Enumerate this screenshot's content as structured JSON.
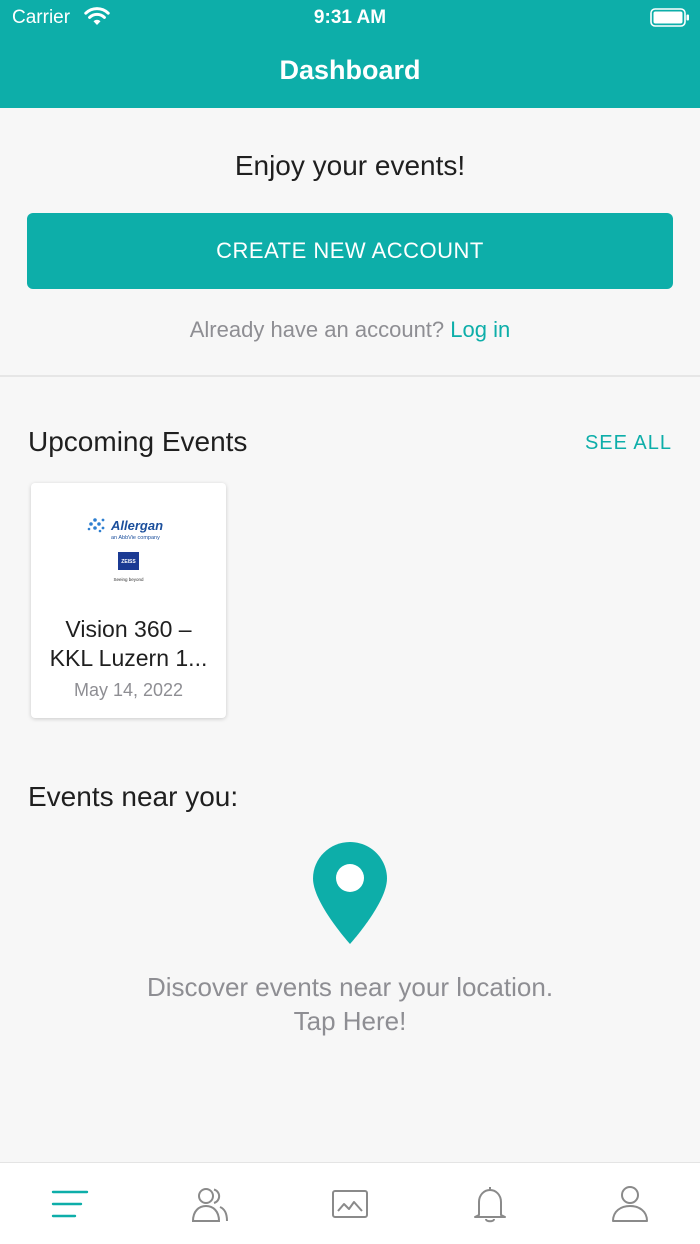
{
  "status_bar": {
    "carrier": "Carrier",
    "time": "9:31 AM"
  },
  "nav": {
    "title": "Dashboard"
  },
  "welcome": {
    "heading": "Enjoy your events!",
    "create_button": "CREATE NEW ACCOUNT",
    "login_prompt": "Already have an account?",
    "login_link": "Log in"
  },
  "upcoming": {
    "title": "Upcoming Events",
    "see_all": "SEE ALL",
    "events": [
      {
        "name": "Vision 360 – KKL Luzern 1...",
        "date": "May 14, 2022",
        "logo": {
          "brand": "Allergan",
          "subtitle": "an AbbVie company",
          "partner": "ZEISS",
          "tagline": "Seeing beyond"
        }
      }
    ]
  },
  "nearby": {
    "title": "Events near you:",
    "discover_line1": "Discover events near your location.",
    "discover_line2": "Tap Here!",
    "icon": "location-pin-icon"
  },
  "tab_bar": {
    "tabs": [
      {
        "name": "menu",
        "icon": "menu-icon",
        "active": true
      },
      {
        "name": "people",
        "icon": "people-icon",
        "active": false
      },
      {
        "name": "gallery",
        "icon": "gallery-icon",
        "active": false
      },
      {
        "name": "notifications",
        "icon": "bell-icon",
        "active": false
      },
      {
        "name": "profile",
        "icon": "profile-icon",
        "active": false
      }
    ]
  },
  "colors": {
    "accent": "#0daea9",
    "background": "#f7f7f7",
    "muted_text": "#8e8e93",
    "inactive_icon": "#8a8a8a"
  }
}
